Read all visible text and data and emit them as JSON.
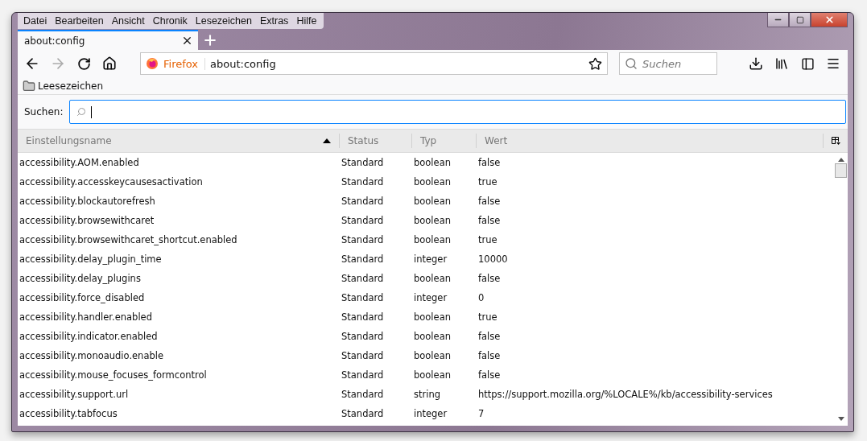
{
  "menu_bar": [
    "Datei",
    "Bearbeiten",
    "Ansicht",
    "Chronik",
    "Lesezeichen",
    "Extras",
    "Hilfe"
  ],
  "tabs": [
    {
      "label": "about:config",
      "selected": true
    }
  ],
  "url_bar": {
    "identity": "Firefox",
    "value": "about:config"
  },
  "search_field": {
    "placeholder": "Suchen"
  },
  "bookmarks": [
    {
      "label": "Leesezeichen"
    }
  ],
  "filter": {
    "label": "Suchen:"
  },
  "table": {
    "columns": [
      {
        "label": "Einstellungsname",
        "sorted": true
      },
      {
        "label": "Status",
        "sorted": false
      },
      {
        "label": "Typ",
        "sorted": false
      },
      {
        "label": "Wert",
        "sorted": false
      }
    ],
    "rows": [
      [
        "accessibility.AOM.enabled",
        "Standard",
        "boolean",
        "false"
      ],
      [
        "accessibility.accesskeycausesactivation",
        "Standard",
        "boolean",
        "true"
      ],
      [
        "accessibility.blockautorefresh",
        "Standard",
        "boolean",
        "false"
      ],
      [
        "accessibility.browsewithcaret",
        "Standard",
        "boolean",
        "false"
      ],
      [
        "accessibility.browsewithcaret_shortcut.enabled",
        "Standard",
        "boolean",
        "true"
      ],
      [
        "accessibility.delay_plugin_time",
        "Standard",
        "integer",
        "10000"
      ],
      [
        "accessibility.delay_plugins",
        "Standard",
        "boolean",
        "false"
      ],
      [
        "accessibility.force_disabled",
        "Standard",
        "integer",
        "0"
      ],
      [
        "accessibility.handler.enabled",
        "Standard",
        "boolean",
        "true"
      ],
      [
        "accessibility.indicator.enabled",
        "Standard",
        "boolean",
        "false"
      ],
      [
        "accessibility.monoaudio.enable",
        "Standard",
        "boolean",
        "false"
      ],
      [
        "accessibility.mouse_focuses_formcontrol",
        "Standard",
        "boolean",
        "false"
      ],
      [
        "accessibility.support.url",
        "Standard",
        "string",
        "https://support.mozilla.org/%LOCALE%/kb/accessibility-services"
      ],
      [
        "accessibility.tabfocus",
        "Standard",
        "integer",
        "7"
      ]
    ]
  }
}
